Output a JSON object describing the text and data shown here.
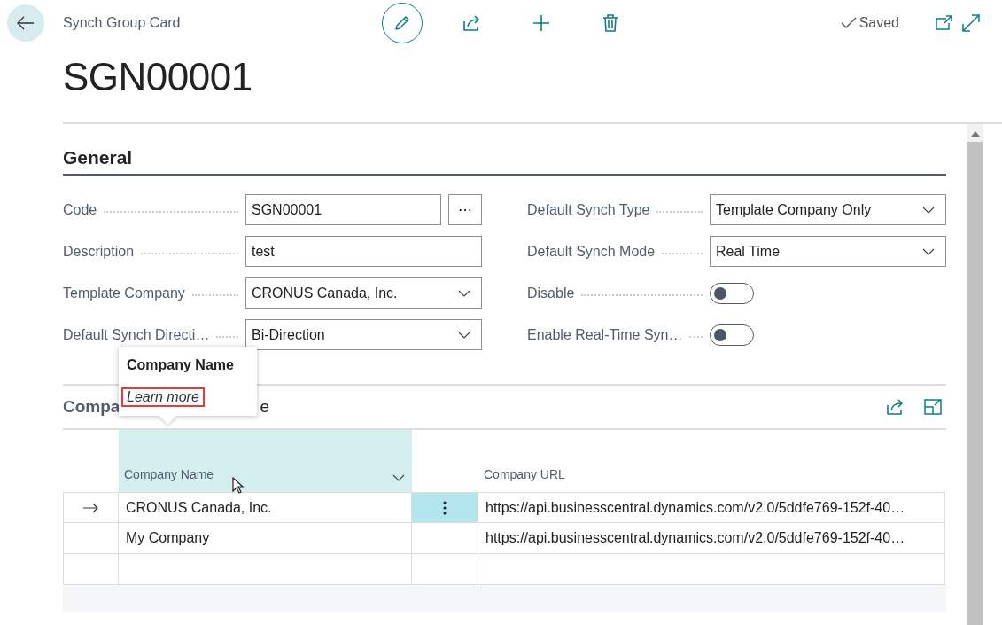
{
  "header": {
    "breadcrumb": "Synch Group Card",
    "status": "Saved",
    "title": "SGN00001"
  },
  "section": {
    "title": "General"
  },
  "fields_left": [
    {
      "kind": "input",
      "label": "Code",
      "value": "SGN00001",
      "lookup": "⋯"
    },
    {
      "kind": "input",
      "label": "Description",
      "value": "test"
    },
    {
      "kind": "select",
      "label": "Template Company",
      "value": "CRONUS Canada, Inc."
    },
    {
      "kind": "select",
      "label": "Default Synch Directi…",
      "value": "Bi-Direction"
    }
  ],
  "fields_right": [
    {
      "kind": "select",
      "label": "Default Synch Type",
      "value": "Template Company Only"
    },
    {
      "kind": "select",
      "label": "Default Synch Mode",
      "value": "Real Time"
    },
    {
      "kind": "toggle",
      "label": "Disable",
      "on": false
    },
    {
      "kind": "toggle",
      "label": "Enable Real-Time Syn…",
      "on": false
    }
  ],
  "tooltip": {
    "title": "Company Name",
    "link": "Learn more",
    "highlighted": true
  },
  "subpage": {
    "title_start": "Compa",
    "title_end": "e"
  },
  "table": {
    "columns": [
      {
        "label": "Company Name",
        "selected": true
      },
      {
        "label": "Company URL",
        "selected": false
      }
    ],
    "rows": [
      {
        "current": true,
        "name": "CRONUS Canada, Inc.",
        "url": "https://api.businesscentral.dynamics.com/v2.0/5ddfe769-152f-40…"
      },
      {
        "current": false,
        "name": "My Company",
        "url": "https://api.businesscentral.dynamics.com/v2.0/5ddfe769-152f-40…"
      }
    ]
  }
}
